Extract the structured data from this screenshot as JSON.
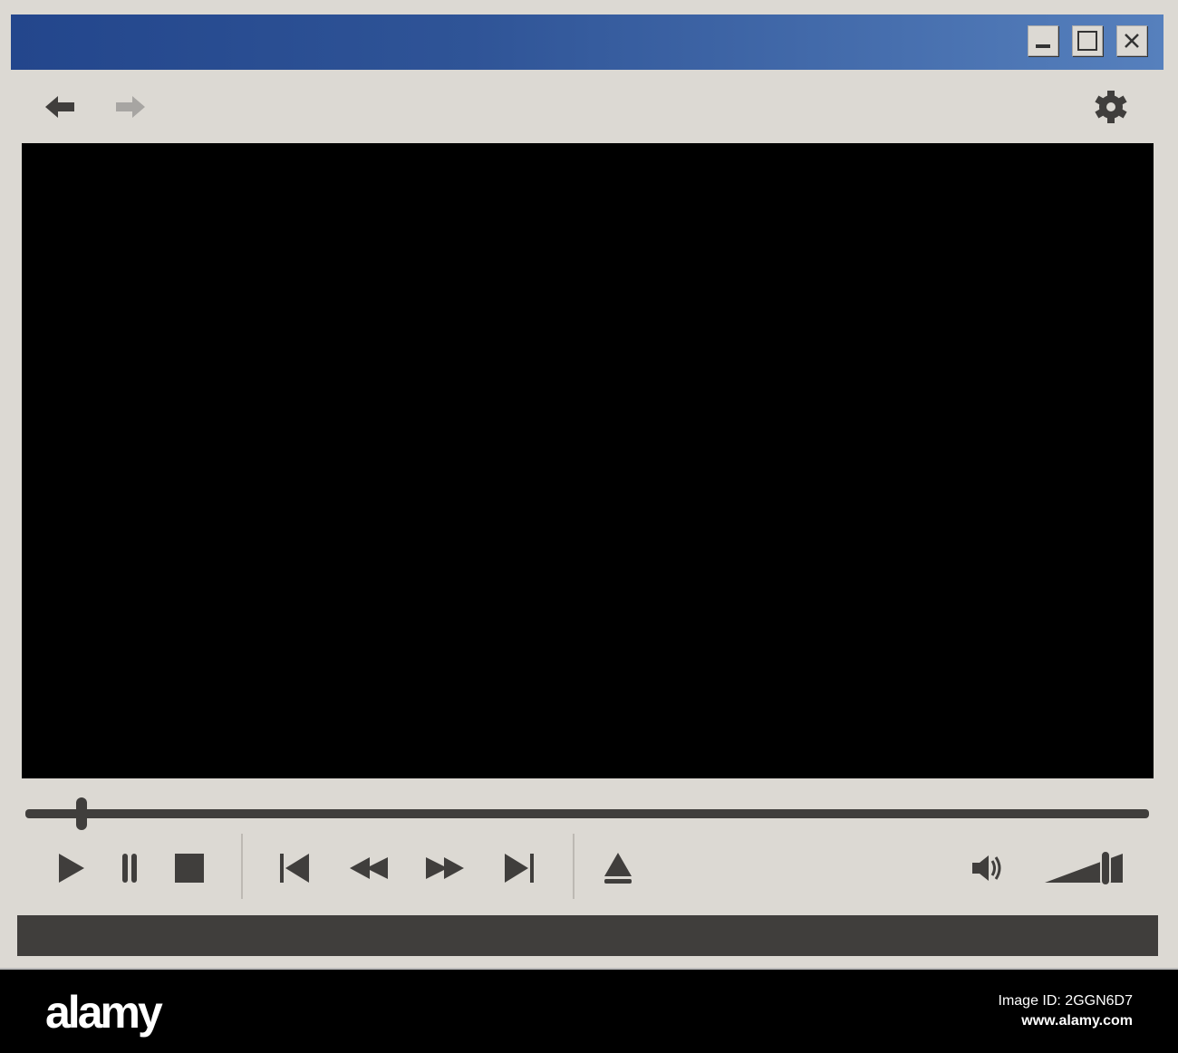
{
  "window": {
    "controls": {
      "minimize": "minimize",
      "maximize": "maximize",
      "close": "close"
    }
  },
  "toolbar": {
    "icons": [
      "arrow-left-icon",
      "arrow-right-icon",
      "gear-icon"
    ]
  },
  "player": {
    "seek_progress_percent": 4,
    "volume_percent": 100,
    "back_enabled": true,
    "forward_enabled": false
  },
  "colors": {
    "titlebar_start": "#23468c",
    "titlebar_end": "#5680bd",
    "chrome": "#dcd9d3",
    "controls": "#403e3c"
  },
  "footer": {
    "logo": "alamy",
    "image_id": "Image ID: 2GGN6D7",
    "url": "www.alamy.com"
  }
}
